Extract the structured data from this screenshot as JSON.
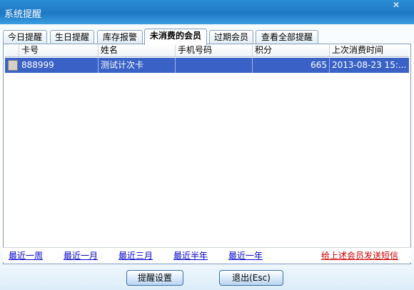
{
  "window": {
    "title": "系统提醒",
    "close_symbol": "✕"
  },
  "tabs": [
    {
      "label": "今日提醒",
      "active": false
    },
    {
      "label": "生日提醒",
      "active": false
    },
    {
      "label": "库存报警",
      "active": false
    },
    {
      "label": "未消费的会员",
      "active": true
    },
    {
      "label": "过期会员",
      "active": false
    },
    {
      "label": "查看全部提醒",
      "active": false
    }
  ],
  "table": {
    "columns": [
      "卡号",
      "姓名",
      "手机号码",
      "积分",
      "上次消费时间"
    ],
    "rows": [
      {
        "card_no": "888999",
        "name": "测试计次卡",
        "phone": "",
        "points": "665",
        "last_consume": "2013-08-23 15:..."
      }
    ]
  },
  "range_links": [
    "最近一周",
    "最近一月",
    "最近三月",
    "最近半年",
    "最近一年"
  ],
  "sms_link": "给上述会员发送短信",
  "buttons": {
    "settings": "提醒设置",
    "exit": "退出(Esc)"
  }
}
